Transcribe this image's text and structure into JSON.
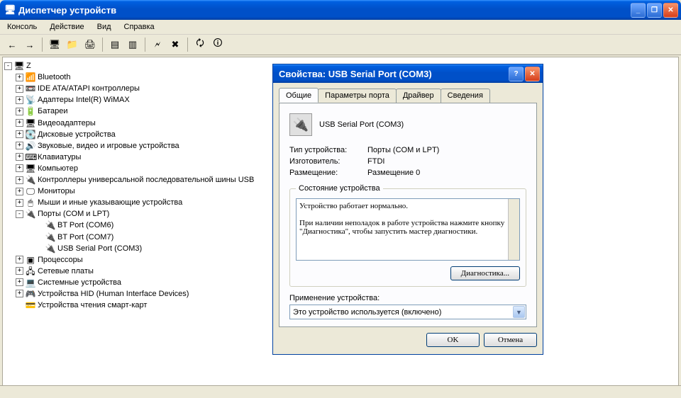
{
  "window": {
    "title": "Диспетчер устройств"
  },
  "menu": {
    "console": "Консоль",
    "action": "Действие",
    "view": "Вид",
    "help": "Справка"
  },
  "tree": {
    "root": "Z",
    "items": [
      {
        "label": "Bluetooth",
        "icon": "📶",
        "exp": "+"
      },
      {
        "label": "IDE ATA/ATAPI контроллеры",
        "icon": "📼",
        "exp": "+"
      },
      {
        "label": "Адаптеры Intel(R) WiMAX",
        "icon": "📡",
        "exp": "+"
      },
      {
        "label": "Батареи",
        "icon": "🔋",
        "exp": "+"
      },
      {
        "label": "Видеоадаптеры",
        "icon": "🖥",
        "exp": "+"
      },
      {
        "label": "Дисковые устройства",
        "icon": "💽",
        "exp": "+"
      },
      {
        "label": "Звуковые, видео и игровые устройства",
        "icon": "🔊",
        "exp": "+"
      },
      {
        "label": "Клавиатуры",
        "icon": "⌨",
        "exp": "+"
      },
      {
        "label": "Компьютер",
        "icon": "🖥",
        "exp": "+"
      },
      {
        "label": "Контроллеры универсальной последовательной шины USB",
        "icon": "🔌",
        "exp": "+"
      },
      {
        "label": "Мониторы",
        "icon": "🖵",
        "exp": "+"
      },
      {
        "label": "Мыши и иные указывающие устройства",
        "icon": "🖱",
        "exp": "+"
      },
      {
        "label": "Порты (COM и LPT)",
        "icon": "🔌",
        "exp": "-",
        "children": [
          {
            "label": "BT Port (COM6)",
            "icon": "🔌"
          },
          {
            "label": "BT Port (COM7)",
            "icon": "🔌"
          },
          {
            "label": "USB Serial Port (COM3)",
            "icon": "🔌"
          }
        ]
      },
      {
        "label": "Процессоры",
        "icon": "▣",
        "exp": "+"
      },
      {
        "label": "Сетевые платы",
        "icon": "🖧",
        "exp": "+"
      },
      {
        "label": "Системные устройства",
        "icon": "💻",
        "exp": "+"
      },
      {
        "label": "Устройства HID (Human Interface Devices)",
        "icon": "🎮",
        "exp": "+"
      },
      {
        "label": "Устройства чтения смарт-карт",
        "icon": "💳",
        "exp": ""
      }
    ]
  },
  "dialog": {
    "title": "Свойства: USB Serial Port (COM3)",
    "tabs": {
      "general": "Общие",
      "port": "Параметры порта",
      "driver": "Драйвер",
      "details": "Сведения"
    },
    "device_name": "USB Serial Port (COM3)",
    "rows": {
      "type_k": "Тип устройства:",
      "type_v": "Порты (COM и LPT)",
      "mfr_k": "Изготовитель:",
      "mfr_v": "FTDI",
      "loc_k": "Размещение:",
      "loc_v": "Размещение 0"
    },
    "status_legend": "Состояние устройства",
    "status_text": "Устройство работает нормально.\n\nПри наличии неполадок в работе устройства нажмите кнопку \"Диагностика\", чтобы запустить мастер диагностики.",
    "diag_btn": "Диагностика...",
    "usage_label": "Применение устройства:",
    "usage_value": "Это устройство используется (включено)",
    "ok": "OK",
    "cancel": "Отмена"
  }
}
